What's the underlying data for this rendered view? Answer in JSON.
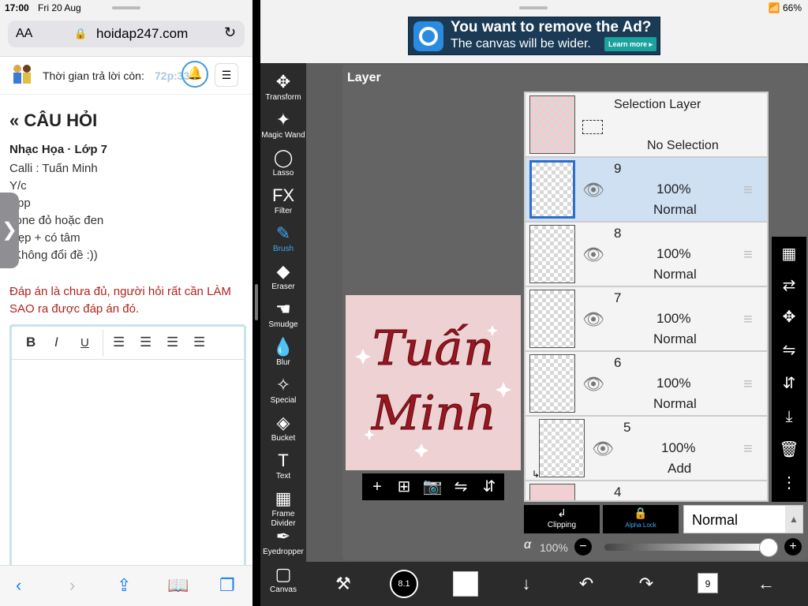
{
  "safari": {
    "status": {
      "time": "17:00",
      "date": "Fri 20 Aug"
    },
    "url_bar": {
      "aa": "AA",
      "domain": "hoidap247.com"
    },
    "timer": {
      "label": "Thời gian trả lời còn:",
      "value": "72p:33"
    },
    "question": {
      "heading": "CÂU HỎI",
      "meta": "Nhạc Họa · Lớp 7",
      "lines": [
        "Calli : Tuấn Minh",
        "Y/c",
        "App",
        "Tone đỏ hoặc đen",
        "Đẹp + có tâm",
        "(Không đổi đề :))"
      ],
      "warning": "Đáp án là chưa đủ, người hỏi rất cần LÀM SAO ra được đáp án đó."
    },
    "editor_toolbar": {
      "bold": "B",
      "italic": "I",
      "underline": "U"
    }
  },
  "ibispaint": {
    "status": {
      "battery": "66%"
    },
    "ad": {
      "line1": "You want to remove the Ad?",
      "line2": "The canvas will be wider.",
      "cta": "Learn more ▸"
    },
    "tools": [
      {
        "label": "Transform",
        "icon": "✥",
        "active": false
      },
      {
        "label": "Magic Wand",
        "icon": "✦",
        "active": false
      },
      {
        "label": "Lasso",
        "icon": "◯",
        "active": false
      },
      {
        "label": "Filter",
        "icon": "FX",
        "active": false
      },
      {
        "label": "Brush",
        "icon": "✎",
        "active": true
      },
      {
        "label": "Eraser",
        "icon": "◆",
        "active": false
      },
      {
        "label": "Smudge",
        "icon": "☚",
        "active": false
      },
      {
        "label": "Blur",
        "icon": "💧",
        "active": false
      },
      {
        "label": "Special",
        "icon": "✧",
        "active": false
      },
      {
        "label": "Bucket",
        "icon": "◈",
        "active": false
      },
      {
        "label": "Text",
        "icon": "T",
        "active": false
      },
      {
        "label": "Frame Divider",
        "icon": "▦",
        "active": false
      },
      {
        "label": "Eyedropper",
        "icon": "✒",
        "active": false
      },
      {
        "label": "Canvas",
        "icon": "▢",
        "active": false
      }
    ],
    "panel_title": "Layer",
    "artwork": {
      "line1": "Tuấn",
      "line2": "Minh"
    },
    "selection_layer": {
      "title": "Selection Layer",
      "status": "No Selection"
    },
    "layers": [
      {
        "num": "9",
        "opacity": "100%",
        "mode": "Normal",
        "selected": true
      },
      {
        "num": "8",
        "opacity": "100%",
        "mode": "Normal",
        "selected": false
      },
      {
        "num": "7",
        "opacity": "100%",
        "mode": "Normal",
        "selected": false
      },
      {
        "num": "6",
        "opacity": "100%",
        "mode": "Normal",
        "selected": false
      },
      {
        "num": "5",
        "opacity": "100%",
        "mode": "Add",
        "selected": false
      },
      {
        "num": "4",
        "opacity": "",
        "mode": "",
        "selected": false
      }
    ],
    "clipping_label": "Clipping",
    "alpha_lock_label": "Alpha Lock",
    "blend_mode": "Normal",
    "opacity": {
      "symbol": "α",
      "value": "100%",
      "level": 1.0
    },
    "layer_count": "9",
    "brush_size": "8.1"
  }
}
